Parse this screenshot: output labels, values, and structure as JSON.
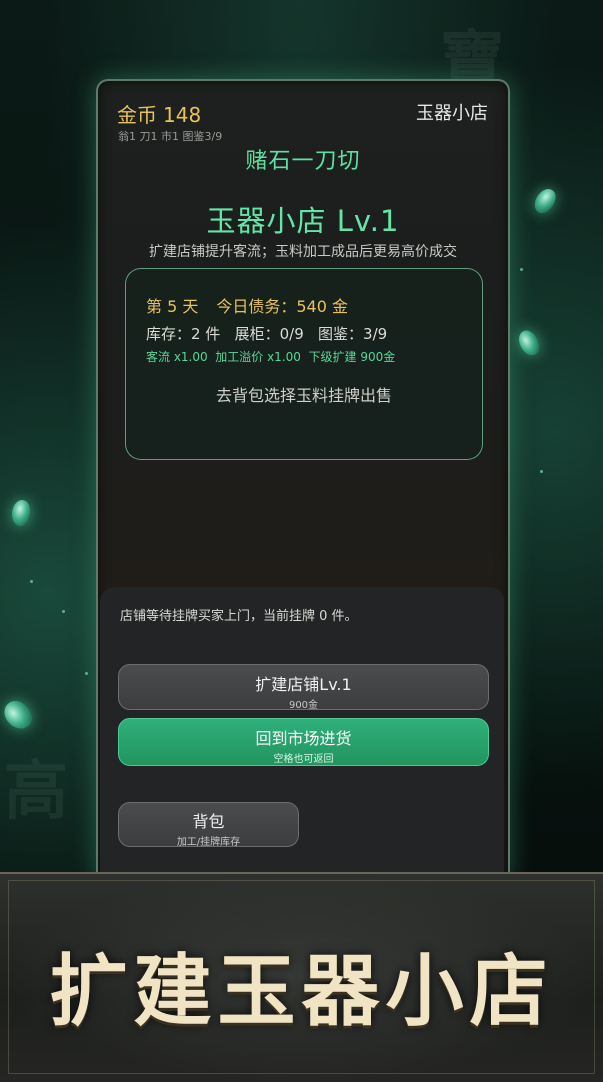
{
  "status": {
    "gold_label": "金币",
    "gold_value": "148",
    "sub_stats": "翁1 刀1 市1 图鉴3/9",
    "shop_name": "玉器小店"
  },
  "game_title": "赌石一刀切",
  "shop": {
    "level_title": "玉器小店 Lv.1",
    "description": "扩建店铺提升客流；玉料加工成品后更易高价成交"
  },
  "info": {
    "day": "第 5 天",
    "debt": "今日债务：540 金",
    "stock_line": "库存：2 件   展柜：0/9   图鉴：3/9",
    "rates_line": "客流 x1.00  加工溢价 x1.00  下级扩建 900金",
    "hint": "去背包选择玉料挂牌出售"
  },
  "panel": {
    "message": "店铺等待挂牌买家上门，当前挂牌 0 件。"
  },
  "buttons": {
    "expand_label": "扩建店铺Lv.1",
    "expand_sub": "900金",
    "market_label": "回到市场进货",
    "market_sub": "空格也可返回",
    "bag_label": "背包",
    "bag_sub": "加工/挂牌库存"
  },
  "banner": {
    "title": "扩建玉器小店"
  },
  "colors": {
    "accent_green": "#5fe0a0",
    "gold": "#e8c35b",
    "market_button": "#2fb07a"
  },
  "icons": [
    "jade-shard-icon"
  ]
}
